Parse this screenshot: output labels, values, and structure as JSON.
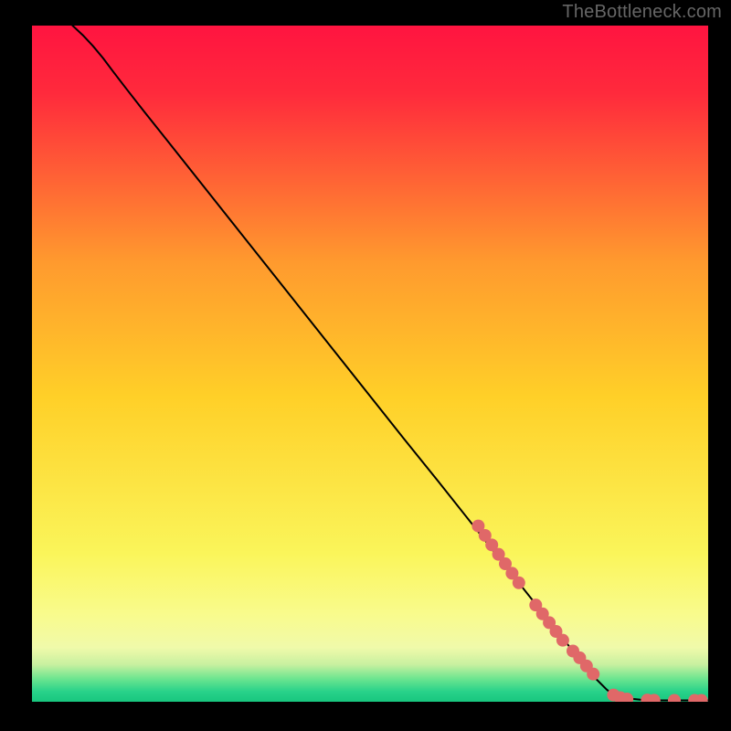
{
  "watermark": "TheBottleneck.com",
  "chart_data": {
    "type": "line",
    "title": "",
    "xlabel": "",
    "ylabel": "",
    "xlim": [
      0,
      100
    ],
    "ylim": [
      0,
      100
    ],
    "grid": false,
    "legend": false,
    "gradient_stops": [
      {
        "pos": 0.0,
        "color": "#ff1440"
      },
      {
        "pos": 0.1,
        "color": "#ff2a3c"
      },
      {
        "pos": 0.35,
        "color": "#ff9a2e"
      },
      {
        "pos": 0.55,
        "color": "#ffd028"
      },
      {
        "pos": 0.78,
        "color": "#faf55a"
      },
      {
        "pos": 0.87,
        "color": "#f9fb8c"
      },
      {
        "pos": 0.92,
        "color": "#f0faaa"
      },
      {
        "pos": 0.945,
        "color": "#c8f0a0"
      },
      {
        "pos": 0.965,
        "color": "#70e690"
      },
      {
        "pos": 0.985,
        "color": "#28d28a"
      },
      {
        "pos": 1.0,
        "color": "#18c67e"
      }
    ],
    "series": [
      {
        "name": "curve",
        "color": "#000000",
        "points": [
          {
            "x": 6.0,
            "y": 100.0
          },
          {
            "x": 7.5,
            "y": 98.6
          },
          {
            "x": 9.0,
            "y": 97.0
          },
          {
            "x": 10.5,
            "y": 95.2
          },
          {
            "x": 12.0,
            "y": 93.2
          },
          {
            "x": 14.0,
            "y": 90.6
          },
          {
            "x": 16.5,
            "y": 87.4
          },
          {
            "x": 20.0,
            "y": 83.0
          },
          {
            "x": 25.0,
            "y": 76.7
          },
          {
            "x": 30.0,
            "y": 70.4
          },
          {
            "x": 35.0,
            "y": 64.1
          },
          {
            "x": 40.0,
            "y": 57.8
          },
          {
            "x": 45.0,
            "y": 51.5
          },
          {
            "x": 50.0,
            "y": 45.2
          },
          {
            "x": 55.0,
            "y": 38.9
          },
          {
            "x": 60.0,
            "y": 32.7
          },
          {
            "x": 65.0,
            "y": 26.4
          },
          {
            "x": 70.0,
            "y": 20.1
          },
          {
            "x": 75.0,
            "y": 13.8
          },
          {
            "x": 80.0,
            "y": 7.5
          },
          {
            "x": 83.0,
            "y": 3.8
          },
          {
            "x": 85.0,
            "y": 1.8
          },
          {
            "x": 86.0,
            "y": 1.0
          },
          {
            "x": 88.0,
            "y": 0.5
          },
          {
            "x": 90.0,
            "y": 0.3
          },
          {
            "x": 93.0,
            "y": 0.2
          },
          {
            "x": 96.0,
            "y": 0.2
          },
          {
            "x": 100.0,
            "y": 0.2
          }
        ]
      }
    ],
    "markers": {
      "name": "highlighted-range",
      "color": "#e06868",
      "radius_px": 7,
      "points": [
        {
          "x": 66.0,
          "y": 26.0
        },
        {
          "x": 67.0,
          "y": 24.6
        },
        {
          "x": 68.0,
          "y": 23.2
        },
        {
          "x": 69.0,
          "y": 21.8
        },
        {
          "x": 70.0,
          "y": 20.4
        },
        {
          "x": 71.0,
          "y": 19.0
        },
        {
          "x": 72.0,
          "y": 17.6
        },
        {
          "x": 74.5,
          "y": 14.3
        },
        {
          "x": 75.5,
          "y": 13.0
        },
        {
          "x": 76.5,
          "y": 11.7
        },
        {
          "x": 77.5,
          "y": 10.4
        },
        {
          "x": 78.5,
          "y": 9.1
        },
        {
          "x": 80.0,
          "y": 7.5
        },
        {
          "x": 81.0,
          "y": 6.5
        },
        {
          "x": 82.0,
          "y": 5.3
        },
        {
          "x": 83.0,
          "y": 4.1
        },
        {
          "x": 86.0,
          "y": 1.0
        },
        {
          "x": 87.0,
          "y": 0.6
        },
        {
          "x": 88.0,
          "y": 0.4
        },
        {
          "x": 91.0,
          "y": 0.25
        },
        {
          "x": 92.0,
          "y": 0.22
        },
        {
          "x": 95.0,
          "y": 0.2
        },
        {
          "x": 98.0,
          "y": 0.2
        },
        {
          "x": 99.0,
          "y": 0.2
        }
      ]
    }
  }
}
